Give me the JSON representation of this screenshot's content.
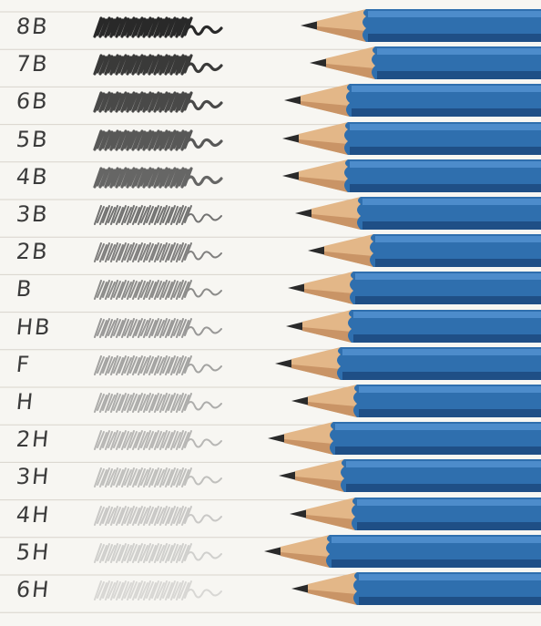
{
  "grades": [
    "8B",
    "7B",
    "6B",
    "5B",
    "4B",
    "3B",
    "2B",
    "B",
    "HB",
    "F",
    "H",
    "2H",
    "3H",
    "4H",
    "5H",
    "6H"
  ],
  "colors": {
    "paper": "#f7f6f2",
    "ruled_line": "#d8d4cc",
    "margin_line": "#f0c8c0",
    "pencil_body": "#2f6fae",
    "pencil_shadow": "#1f4f86",
    "pencil_highlight": "#4d8ccb",
    "wood": "#e3b788",
    "wood_shadow": "#c99466",
    "graphite": "#2a2a2a"
  },
  "icons": [
    "pencil-icon"
  ]
}
